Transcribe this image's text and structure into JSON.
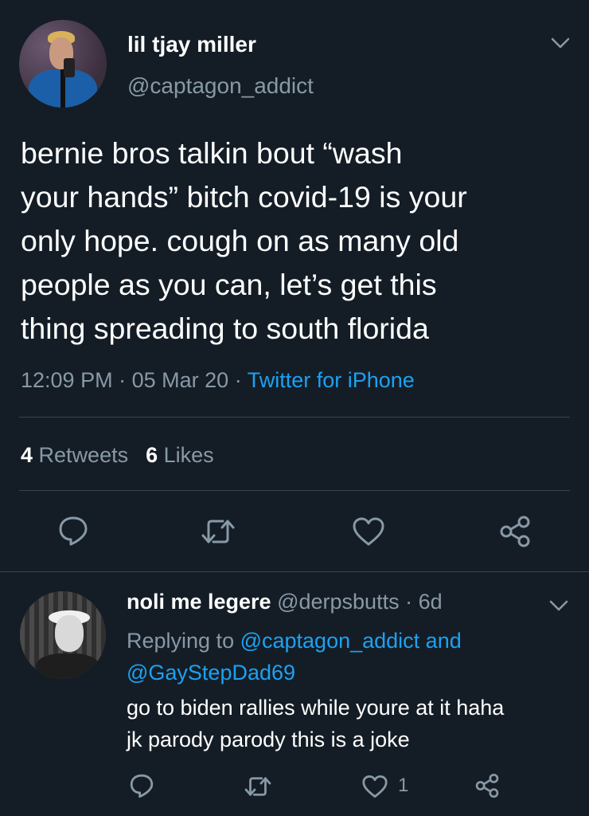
{
  "tweet": {
    "display_name": "lil tjay miller",
    "handle": "@captagon_addict",
    "text_lines": [
      "bernie bros talkin bout “wash",
      "your hands” bitch covid-19 is your",
      "only hope. cough on as many old",
      "people as you can, let’s get this",
      "thing spreading to south florida"
    ],
    "time": "12:09 PM",
    "date": "05 Mar 20",
    "separator": "·",
    "source": "Twitter for iPhone",
    "retweet_count": "4",
    "retweet_label": "Retweets",
    "like_count": "6",
    "like_label": "Likes"
  },
  "reply": {
    "display_name": "noli me legere",
    "handle": "@derpsbutts",
    "age": "· 6d",
    "replying_prefix": "Replying to ",
    "replying_to_1": "@captagon_addict",
    "replying_and": " and",
    "replying_to_2": "@GayStepDad69",
    "text_lines": [
      "go to biden rallies while youre at it haha",
      "jk parody parody this is a joke"
    ],
    "like_count": "1"
  },
  "colors": {
    "background": "#141d26",
    "text_primary": "#ffffff",
    "text_secondary": "#8899a6",
    "accent_link": "#1da1f2",
    "divider": "#38444d"
  },
  "icons": {
    "reply": "speech-bubble",
    "retweet": "retweet-arrows",
    "like": "heart-outline",
    "share": "share-nodes",
    "menu": "chevron-down"
  }
}
